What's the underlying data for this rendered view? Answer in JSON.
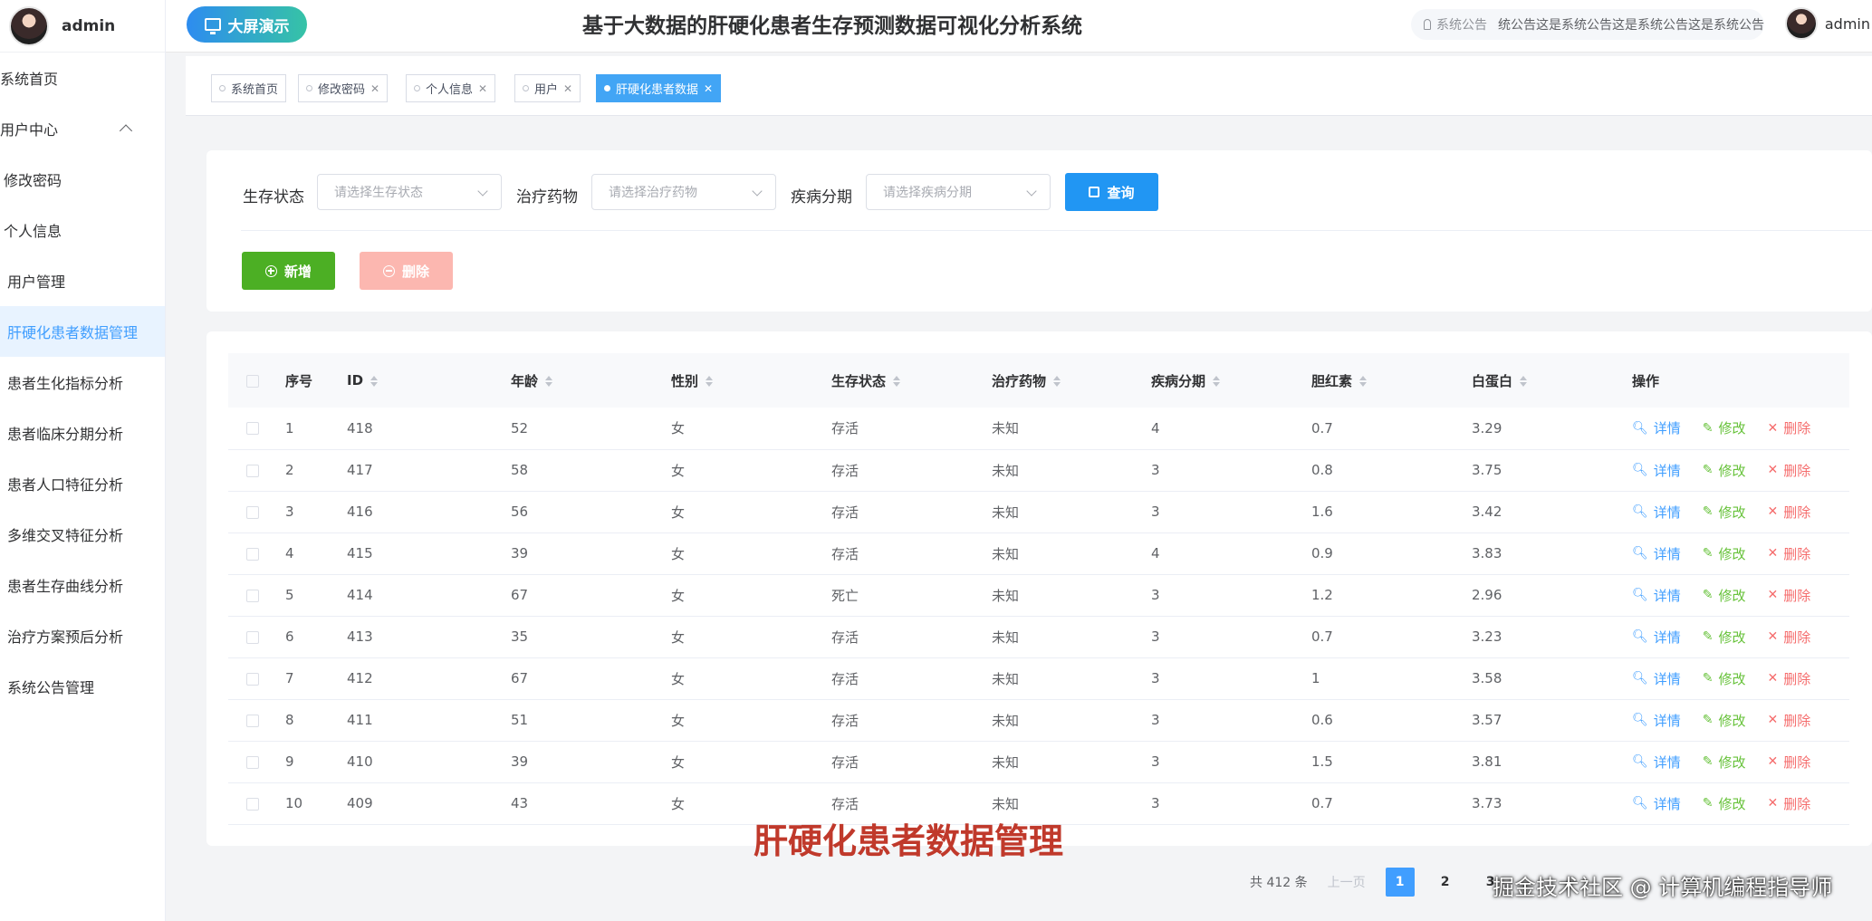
{
  "sidebar": {
    "username": "admin",
    "items": [
      {
        "label": "系统首页",
        "level": 0
      },
      {
        "label": "用户中心",
        "level": 0
      },
      {
        "label": "修改密码",
        "level": 1
      },
      {
        "label": "个人信息",
        "level": 1
      },
      {
        "label": "用户管理",
        "level": 2
      },
      {
        "label": "肝硬化患者数据管理",
        "level": 2
      },
      {
        "label": "患者生化指标分析",
        "level": 2
      },
      {
        "label": "患者临床分期分析",
        "level": 2
      },
      {
        "label": "患者人口特征分析",
        "level": 2
      },
      {
        "label": "多维交叉特征分析",
        "level": 2
      },
      {
        "label": "患者生存曲线分析",
        "level": 2
      },
      {
        "label": "治疗方案预后分析",
        "level": 2
      },
      {
        "label": "系统公告管理",
        "level": 2
      }
    ]
  },
  "header": {
    "screen_button": "大屏演示",
    "title": "基于大数据的肝硬化患者生存预测数据可视化分析系统",
    "notice_label": "系统公告",
    "notice_text": "统公告这是系统公告这是系统公告这是系统公告",
    "username": "admin"
  },
  "tags": [
    {
      "label": "系统首页",
      "closable": false
    },
    {
      "label": "修改密码",
      "closable": true
    },
    {
      "label": "个人信息",
      "closable": true
    },
    {
      "label": "用户",
      "closable": true
    },
    {
      "label": "肝硬化患者数据",
      "closable": true,
      "active": true
    }
  ],
  "search": {
    "status_label": "生存状态",
    "status_placeholder": "请选择生存状态",
    "drug_label": "治疗药物",
    "drug_placeholder": "请选择治疗药物",
    "stage_label": "疾病分期",
    "stage_placeholder": "请选择疾病分期",
    "query_button": "查询",
    "add_button": "新增",
    "delete_button": "删除"
  },
  "table": {
    "columns": [
      "序号",
      "ID",
      "年龄",
      "性别",
      "生存状态",
      "治疗药物",
      "疾病分期",
      "胆红素",
      "白蛋白",
      "操作"
    ],
    "actions": {
      "detail": "详情",
      "edit": "修改",
      "remove": "删除"
    },
    "rows": [
      [
        "1",
        "418",
        "52",
        "女",
        "存活",
        "未知",
        "4",
        "0.7",
        "3.29"
      ],
      [
        "2",
        "417",
        "58",
        "女",
        "存活",
        "未知",
        "3",
        "0.8",
        "3.75"
      ],
      [
        "3",
        "416",
        "56",
        "女",
        "存活",
        "未知",
        "3",
        "1.6",
        "3.42"
      ],
      [
        "4",
        "415",
        "39",
        "女",
        "存活",
        "未知",
        "4",
        "0.9",
        "3.83"
      ],
      [
        "5",
        "414",
        "67",
        "女",
        "死亡",
        "未知",
        "3",
        "1.2",
        "2.96"
      ],
      [
        "6",
        "413",
        "35",
        "女",
        "存活",
        "未知",
        "3",
        "0.7",
        "3.23"
      ],
      [
        "7",
        "412",
        "67",
        "女",
        "存活",
        "未知",
        "3",
        "1",
        "3.58"
      ],
      [
        "8",
        "411",
        "51",
        "女",
        "存活",
        "未知",
        "3",
        "0.6",
        "3.57"
      ],
      [
        "9",
        "410",
        "39",
        "女",
        "存活",
        "未知",
        "3",
        "1.5",
        "3.81"
      ],
      [
        "10",
        "409",
        "43",
        "女",
        "存活",
        "未知",
        "3",
        "0.7",
        "3.73"
      ]
    ]
  },
  "pagination": {
    "total": "共 412 条",
    "prev": "上一页",
    "pages": [
      "1",
      "2",
      "3"
    ],
    "current": "1"
  },
  "overlay": {
    "caption": "肝硬化患者数据管理",
    "watermark": "掘金技术社区 @ 计算机编程指导师"
  },
  "colors": {
    "primary": "#409eff",
    "query": "#2196f3",
    "add": "#4caf24",
    "delete_disabled": "#fcb7b0",
    "edit": "#67c23a",
    "remove": "#f56c6c",
    "caption": "#c0392b"
  }
}
